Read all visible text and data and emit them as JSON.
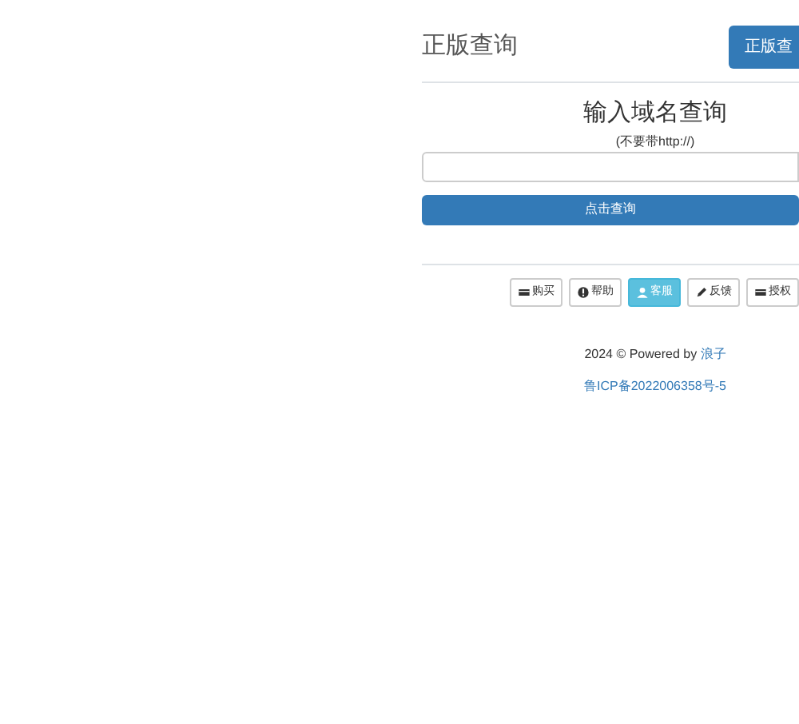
{
  "header": {
    "title": "正版查询",
    "button": "正版查"
  },
  "query": {
    "heading": "输入域名查询",
    "hint": "(不要带http://)",
    "submit": "点击查询"
  },
  "actions": [
    {
      "label": "购买",
      "kind": "card",
      "selected": false
    },
    {
      "label": "帮助",
      "kind": "info",
      "selected": false
    },
    {
      "label": "客服",
      "kind": "user",
      "selected": true
    },
    {
      "label": "反馈",
      "kind": "pencil",
      "selected": false
    },
    {
      "label": "授权",
      "kind": "card",
      "selected": false
    }
  ],
  "footer": {
    "copyright": "2024 © Powered by ",
    "author": "浪子",
    "icp": "鲁ICP备2022006358号-5"
  }
}
